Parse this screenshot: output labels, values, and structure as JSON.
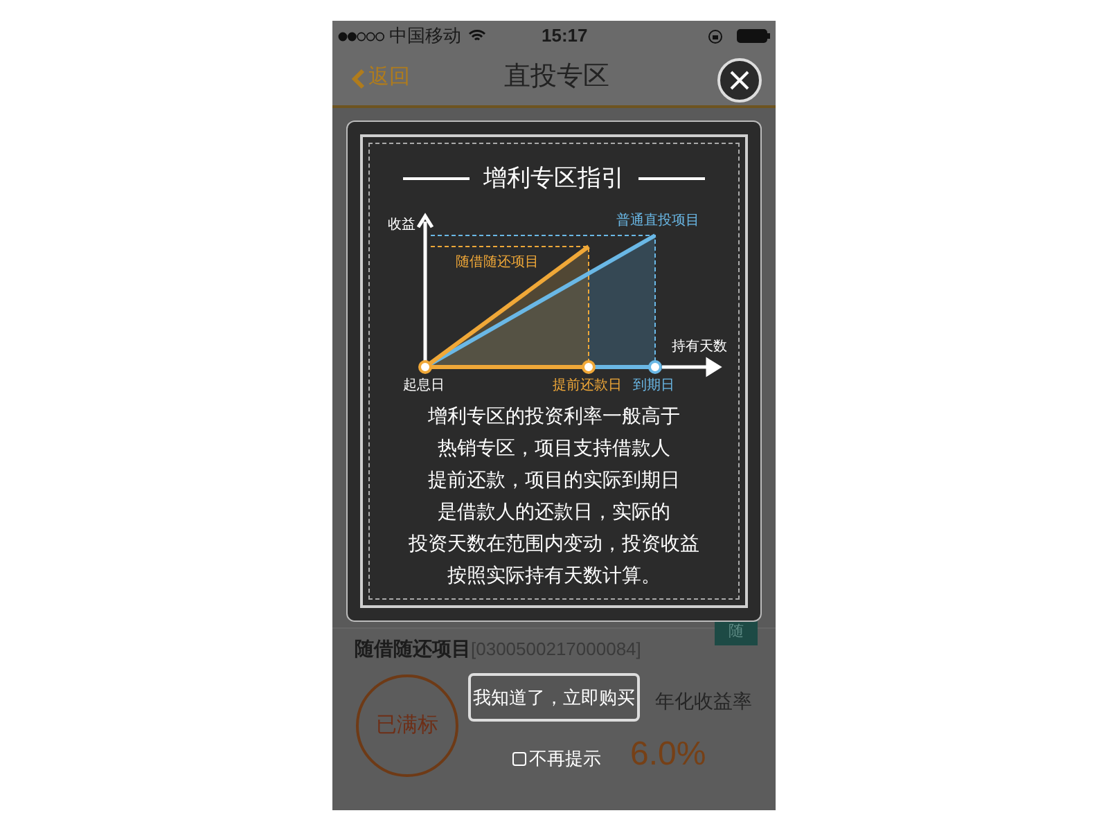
{
  "status_bar": {
    "carrier": "中国移动",
    "time": "15:17"
  },
  "nav": {
    "back": "返回",
    "title": "直投专区"
  },
  "card": {
    "title": "随借随还项目",
    "code": "[0300500217000084]",
    "badge": "随",
    "status": "已满标",
    "rate_label": "年化收益率",
    "rate": "6.0%"
  },
  "guide": {
    "title": "增利专区指引",
    "chart_labels": {
      "y_axis": "收益",
      "x_axis": "持有天数",
      "start": "起息日",
      "early": "提前还款日",
      "maturity": "到期日",
      "flexible": "随借随还项目",
      "regular": "普通直投项目"
    },
    "text_lines": [
      "增利专区的投资利率一般高于",
      "热销专区，项目支持借款人",
      "提前还款，项目的实际到期日",
      "是借款人的还款日，实际的",
      "投资天数在范围内变动，投资收益",
      "按照实际持有天数计算。"
    ]
  },
  "confirm_button": "我知道了，立即购买",
  "dont_show": {
    "label": "不再提示",
    "checked": false
  }
}
